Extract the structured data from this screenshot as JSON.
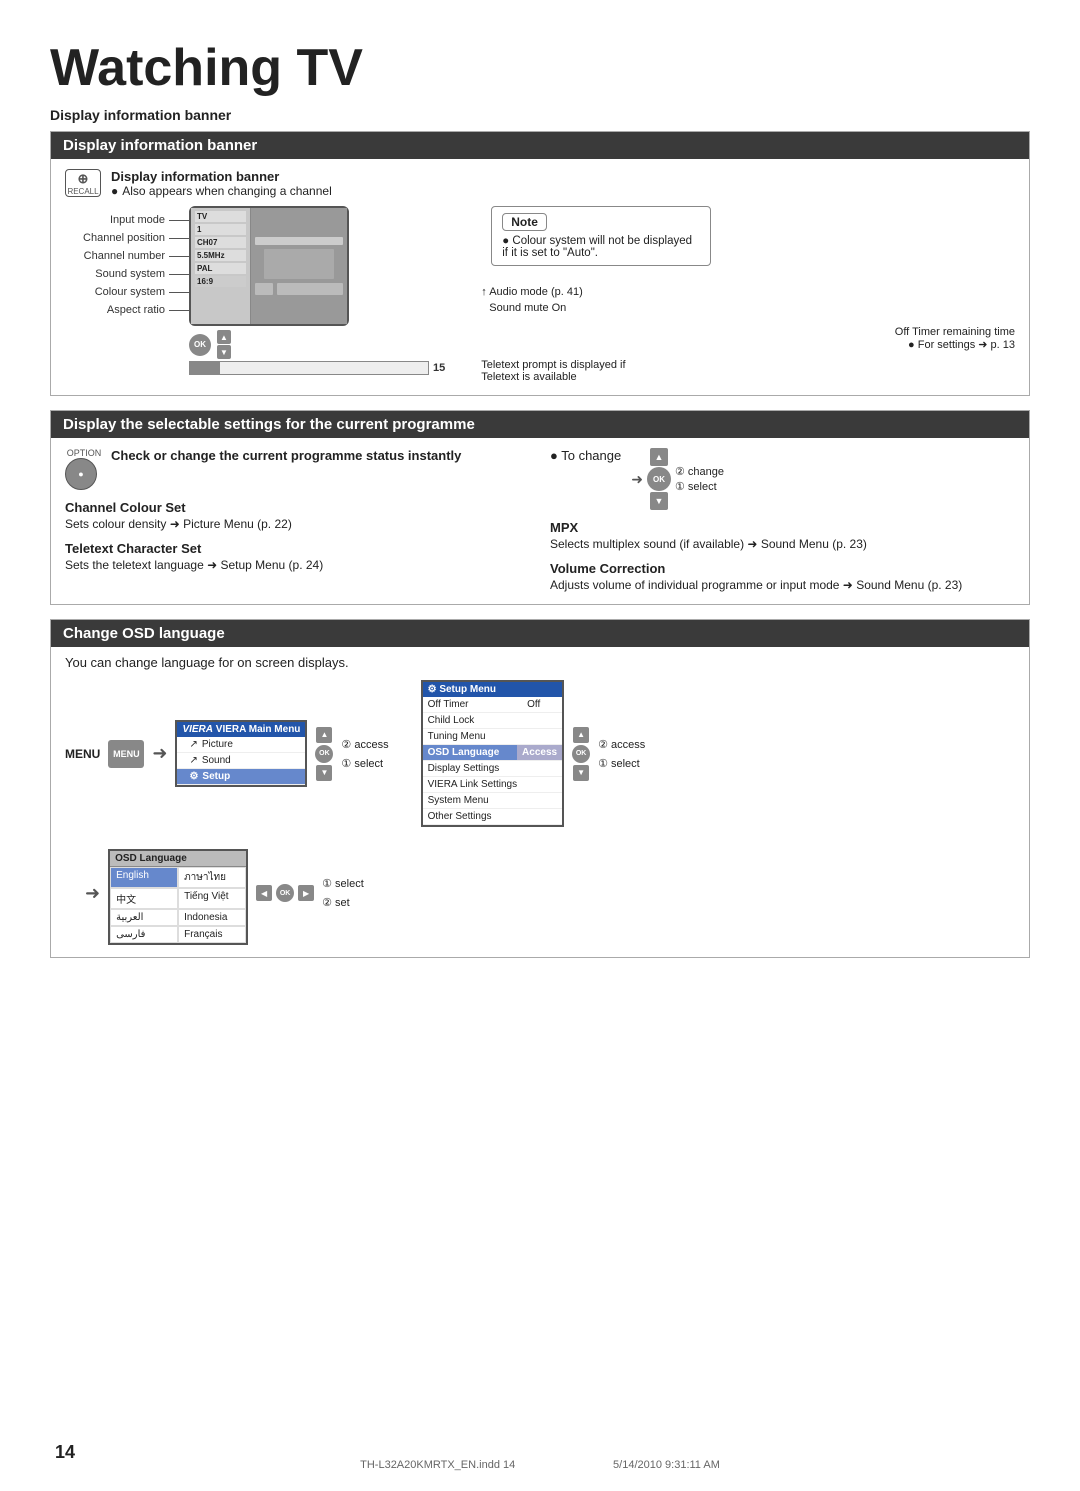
{
  "page": {
    "title": "Watching TV",
    "number": "14",
    "footer": "TH-L32A20KMRTX_EN.indd   14",
    "footer_date": "5/14/2010   9:31:11 AM"
  },
  "section1": {
    "header": "Display information banner",
    "icon_label": "RECALL",
    "title": "Display information banner",
    "subtitle": "Also appears when changing a channel",
    "labels": {
      "input_mode": "Input mode",
      "channel_position": "Channel position",
      "channel_number": "Channel number",
      "sound_system": "Sound system",
      "colour_system": "Colour system",
      "aspect_ratio": "Aspect ratio"
    },
    "values": {
      "input_mode": "TV",
      "channel_position": "1",
      "channel_number": "CH07",
      "sound_system": "5.5MHz",
      "colour_system": "PAL",
      "aspect_ratio": "16:9"
    },
    "audio_mode": "Audio mode (p. 41)",
    "sound_mute": "Sound mute On",
    "off_timer": "Off Timer remaining time",
    "off_timer_ref": "● For settings ➜ p. 13",
    "teletext_prompt": "Teletext prompt is displayed if",
    "teletext_prompt2": "Teletext is available",
    "note_title": "Note",
    "note_text": "● Colour system will not be displayed if it is set to \"Auto\"."
  },
  "section2": {
    "header": "Display the selectable settings for the current programme",
    "option_label": "OPTION",
    "check_change": "Check or change the current programme status instantly",
    "to_change": "● To change",
    "change_label": "② change",
    "select_label": "① select",
    "features": [
      {
        "title": "Channel Colour Set",
        "desc": "Sets colour density ➜ Picture Menu (p. 22)"
      },
      {
        "title": "Teletext Character Set",
        "desc": "Sets the teletext language ➜ Setup Menu (p. 24)"
      },
      {
        "title": "MPX",
        "desc": "Selects multiplex sound (if available) ➜ Sound Menu (p. 23)"
      },
      {
        "title": "Volume Correction",
        "desc": "Adjusts volume of individual programme or input mode ➜ Sound Menu (p. 23)"
      }
    ]
  },
  "section3": {
    "header": "Change OSD language",
    "intro": "You can change language for on screen displays.",
    "menu_label": "MENU",
    "viera_menu": {
      "title": "VIERA Main Menu",
      "items": [
        "Picture",
        "Sound",
        "Setup"
      ],
      "active": "Setup"
    },
    "step1_access": "② access",
    "step1_select": "① select",
    "setup_menu": {
      "title": "Setup Menu",
      "rows": [
        {
          "label": "Off Timer",
          "value": "Off"
        },
        {
          "label": "Child Lock",
          "value": ""
        },
        {
          "label": "Tuning Menu",
          "value": ""
        },
        {
          "label": "OSD Language",
          "value": "Access",
          "highlighted": true
        },
        {
          "label": "Display Settings",
          "value": ""
        },
        {
          "label": "VIERA Link Settings",
          "value": ""
        },
        {
          "label": "System Menu",
          "value": ""
        },
        {
          "label": "Other Settings",
          "value": ""
        }
      ]
    },
    "step2_access": "② access",
    "step2_select": "① select",
    "osd_lang_box": {
      "title": "OSD Language",
      "languages": [
        "English",
        "ภาษาไทย",
        "中文",
        "Tiếng Việt",
        "العربية",
        "Indonesia",
        "فارسی",
        "Français"
      ]
    },
    "step3_select": "① select",
    "step3_set": "② set"
  }
}
